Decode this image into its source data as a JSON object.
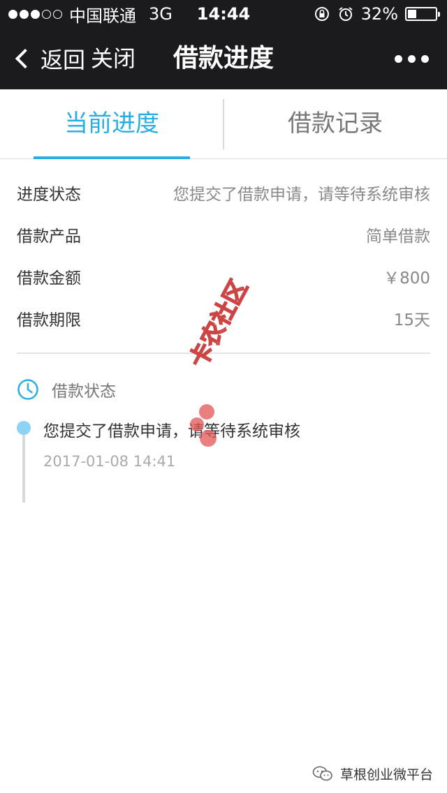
{
  "status_bar": {
    "carrier": "中国联通",
    "network": "3G",
    "time": "14:44",
    "battery_percent": "32%",
    "battery_level": 0.32,
    "icons": [
      "rotation-lock-icon",
      "alarm-icon"
    ]
  },
  "nav": {
    "back_label": "返回",
    "close_label": "关闭",
    "title": "借款进度",
    "more_icon": "more-dots-icon"
  },
  "tabs": [
    {
      "label": "当前进度",
      "active": true
    },
    {
      "label": "借款记录",
      "active": false
    }
  ],
  "details": [
    {
      "label": "进度状态",
      "value": "您提交了借款申请，请等待系统审核"
    },
    {
      "label": "借款产品",
      "value": "简单借款"
    },
    {
      "label": "借款金额",
      "value": "￥800"
    },
    {
      "label": "借款期限",
      "value": "15天"
    }
  ],
  "status_section": {
    "header": "借款状态",
    "header_icon": "clock-icon",
    "timeline": [
      {
        "text": "您提交了借款申请，请等待系统审核",
        "time": "2017-01-08 14:41"
      }
    ]
  },
  "watermark": {
    "text": "卡农社区"
  },
  "footer": {
    "text": "草根创业微平台",
    "icon": "wechat-icon"
  },
  "colors": {
    "accent": "#29aee3",
    "timeline_dot": "#8dd3f5",
    "bar_bg": "#1b1b1d"
  }
}
